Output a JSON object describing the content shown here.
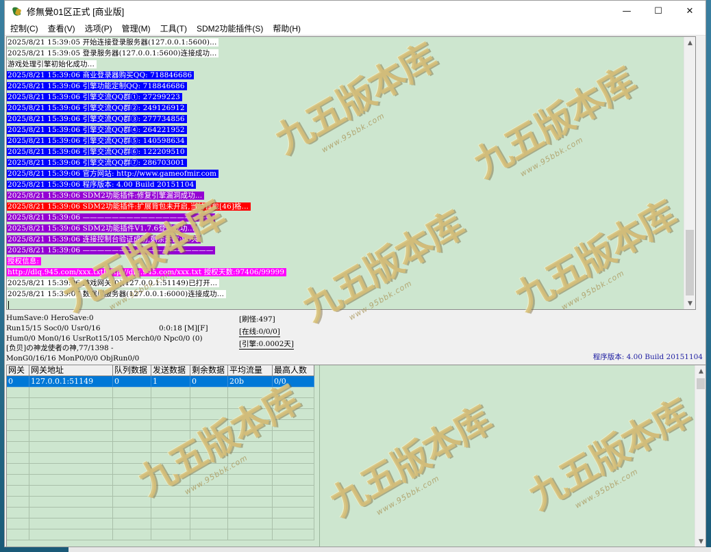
{
  "window": {
    "title": "修無覺01区正式 [商业版]",
    "controls": {
      "minimize": "—",
      "maximize": "☐",
      "close": "✕"
    }
  },
  "menu": [
    "控制(C)",
    "查看(V)",
    "选项(P)",
    "管理(M)",
    "工具(T)",
    "SDM2功能插件(S)",
    "帮助(H)"
  ],
  "log": [
    {
      "text": "2025/8/21 15:39:05 开始连接登录服务器(127.0.0.1:5600)...",
      "style": "white"
    },
    {
      "text": "2025/8/21 15:39:05 登录服务器(127.0.0.1:5600)连接成功...",
      "style": "white"
    },
    {
      "text": "游戏处理引擎初始化成功...",
      "style": "white"
    },
    {
      "text": "2025/8/21 15:39:06 商业登录器购买QQ: 718846686",
      "style": "blue"
    },
    {
      "text": "2025/8/21 15:39:06 引擎功能定制QQ: 718846686",
      "style": "blue"
    },
    {
      "text": "2025/8/21 15:39:06 引擎交流QQ群①: 27299223",
      "style": "blue"
    },
    {
      "text": "2025/8/21 15:39:06 引擎交流QQ群②: 249126912",
      "style": "blue"
    },
    {
      "text": "2025/8/21 15:39:06 引擎交流QQ群③: 277734856",
      "style": "blue"
    },
    {
      "text": "2025/8/21 15:39:06 引擎交流QQ群④: 264221952",
      "style": "blue"
    },
    {
      "text": "2025/8/21 15:39:06 引擎交流QQ群⑤: 140598634",
      "style": "blue"
    },
    {
      "text": "2025/8/21 15:39:06 引擎交流QQ群⑥: 122209510",
      "style": "blue"
    },
    {
      "text": "2025/8/21 15:39:06 引擎交流QQ群⑦: 286703001",
      "style": "blue"
    },
    {
      "text": "2025/8/21 15:39:06 官方网站: http://www.gameofmir.com",
      "style": "blue"
    },
    {
      "text": "2025/8/21 15:39:06 程序版本: 4.00 Build 20151104",
      "style": "blue"
    },
    {
      "text": "2025/8/21 15:39:06 SDM2功能插件:修复引擎漏洞成功...",
      "style": "purple"
    },
    {
      "text": "2025/8/21 15:39:06 SDM2功能插件:扩展背包未开启,当前背包[46]格...",
      "style": "red"
    },
    {
      "text": "2025/8/21 15:39:06 ——————————————————",
      "style": "purple"
    },
    {
      "text": "2025/8/21 15:39:06 SDM2功能插件V1.7.6登录成功...",
      "style": "purple"
    },
    {
      "text": "2025/8/21 15:39:06 连接控制台验证成功,剩余天数:90天",
      "style": "purple"
    },
    {
      "text": "2025/8/21 15:39:06 ——————————————————",
      "style": "purple"
    },
    {
      "text": "授权信息:",
      "style": "magenta"
    },
    {
      "text": "http://dlq.945.com/xxx.txt|http://dlq.945.com/xxx.txt 授权天数:97406/99999",
      "style": "magenta"
    },
    {
      "text": "2025/8/21 15:39:06 游戏网关[0](127.0.0.1:51149)已打开...",
      "style": "white"
    },
    {
      "text": "2025/8/21 15:39:07 数据库服务器(127.0.0.1:6000)连接成功...",
      "style": "white"
    }
  ],
  "status": {
    "line1": "HumSave:0 HeroSave:0",
    "line2a": "Run15/15 Soc0/0 Usr0/16",
    "line2b": "0:0:18 [M][F]",
    "line3": "Hum0/0 Mon0/16 UsrRot15/105 Merch0/0 Npc0/0 (0)",
    "line4": "[负贝]の神龙使者の神,77/1398 -",
    "line5": "MonG0/16/16 MonP0/0/0 ObjRun0/0",
    "refresh": "[刷怪:497]",
    "online": "[在线:0/0/0]",
    "engine": "[引擎:0.0002天]",
    "version": "程序版本: 4.00 Build 20151104"
  },
  "grid": {
    "headers": [
      "网关",
      "网关地址",
      "队列数据",
      "发送数据",
      "剩余数据",
      "平均流量",
      "最高人数"
    ],
    "rows": [
      [
        "0",
        "127.0.0.1:51149",
        "0",
        "1",
        "0",
        "20b",
        "0/0"
      ]
    ]
  },
  "watermark": {
    "main": "九五版本库",
    "sub": "www.95bbk.com"
  },
  "colors": {
    "log_bg": "#cde6cf",
    "blue": "#0000ff",
    "purple": "#9400d3",
    "red": "#ff0000",
    "magenta": "#ff00ff",
    "selection": "#0078d7"
  }
}
